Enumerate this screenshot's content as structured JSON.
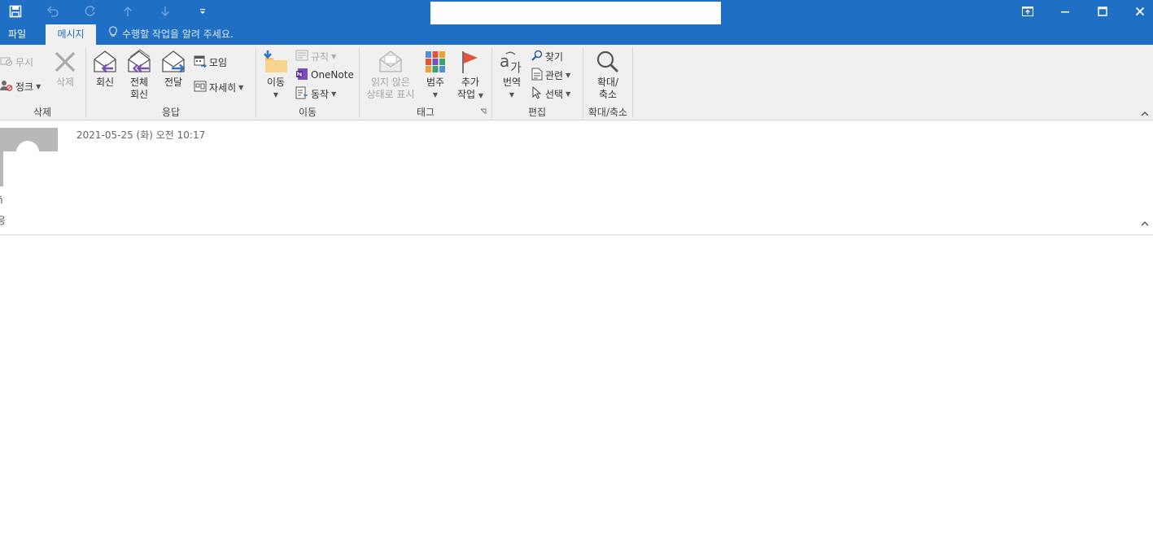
{
  "titlebar": {
    "qat_icons": [
      "save-icon",
      "undo-icon",
      "redo-icon",
      "up-arrow-icon",
      "down-arrow-icon",
      "customize-qat-icon"
    ],
    "window_buttons": [
      "ribbon-display-options-icon",
      "minimize-icon",
      "maximize-icon",
      "close-icon"
    ]
  },
  "tabs": {
    "file": "파일",
    "message": "메시지",
    "tell_me": "수행할 작업을 알려 주세요."
  },
  "ribbon": {
    "delete_group": {
      "label": "삭제",
      "ignore": "무시",
      "cleanup": "정크",
      "delete": "삭제"
    },
    "respond_group": {
      "label": "응답",
      "reply": "회신",
      "reply_all_line1": "전체",
      "reply_all_line2": "회신",
      "forward": "전달",
      "meeting": "모임",
      "more": "자세히"
    },
    "move_group": {
      "label": "이동",
      "move": "이동",
      "rules": "규칙",
      "onenote": "OneNote",
      "actions": "동작"
    },
    "tags_group": {
      "label": "태그",
      "mark_unread_line1": "읽지 않은",
      "mark_unread_line2": "상태로 표시",
      "categorize": "범주",
      "followup_line1": "추가",
      "followup_line2": "작업"
    },
    "edit_group": {
      "label": "편집",
      "translate": "번역",
      "find": "찾기",
      "related": "관련",
      "select": "선택"
    },
    "zoom_group": {
      "label": "확대/축소",
      "zoom_line1": "확대/",
      "zoom_line2": "축소"
    }
  },
  "message": {
    "date": "2021-05-25 (화) 오전 10:17",
    "edge_char_1": "ñ",
    "edge_char_2": "응"
  },
  "colors": {
    "accent": "#1f6fc5",
    "ribbon_bg": "#f0f0f0",
    "reply_purple": "#7b4fb5",
    "forward_blue": "#2e75c8",
    "flag_red": "#e0553a"
  }
}
